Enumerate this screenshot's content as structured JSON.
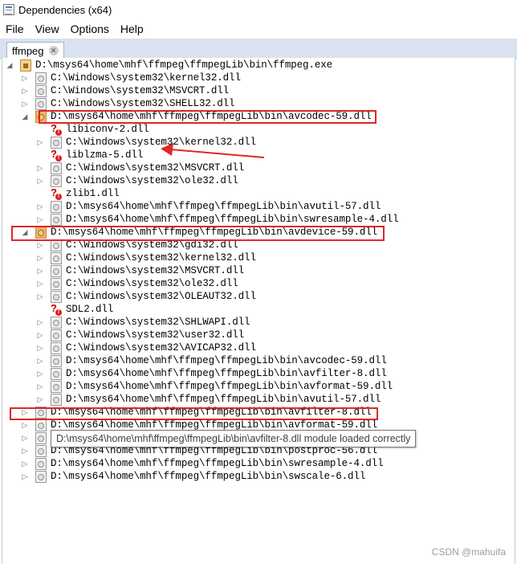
{
  "window": {
    "title": "Dependencies (x64)"
  },
  "menu": [
    "File",
    "View",
    "Options",
    "Help"
  ],
  "tabs": [
    {
      "label": "ffmpeg",
      "close_glyph": "✕"
    }
  ],
  "tree": [
    {
      "depth": 0,
      "expander": "expanded",
      "icon": "exe",
      "label": "D:\\msys64\\home\\mhf\\ffmpeg\\ffmpegLib\\bin\\ffmpeg.exe"
    },
    {
      "depth": 1,
      "expander": "collapsed",
      "icon": "dll",
      "label": "C:\\Windows\\system32\\kernel32.dll"
    },
    {
      "depth": 1,
      "expander": "collapsed",
      "icon": "dll",
      "label": "C:\\Windows\\system32\\MSVCRT.dll"
    },
    {
      "depth": 1,
      "expander": "collapsed",
      "icon": "dll",
      "label": "C:\\Windows\\system32\\SHELL32.dll"
    },
    {
      "depth": 1,
      "expander": "expanded",
      "icon": "hl",
      "label": "D:\\msys64\\home\\mhf\\ffmpeg\\ffmpegLib\\bin\\avcodec-59.dll"
    },
    {
      "depth": 2,
      "expander": "none",
      "icon": "missing",
      "label": "libiconv-2.dll"
    },
    {
      "depth": 2,
      "expander": "collapsed",
      "icon": "dll",
      "label": "C:\\Windows\\system32\\kernel32.dll"
    },
    {
      "depth": 2,
      "expander": "none",
      "icon": "missing",
      "label": "liblzma-5.dll"
    },
    {
      "depth": 2,
      "expander": "collapsed",
      "icon": "dll",
      "label": "C:\\Windows\\system32\\MSVCRT.dll"
    },
    {
      "depth": 2,
      "expander": "collapsed",
      "icon": "dll",
      "label": "C:\\Windows\\system32\\ole32.dll"
    },
    {
      "depth": 2,
      "expander": "none",
      "icon": "missing",
      "label": "zlib1.dll"
    },
    {
      "depth": 2,
      "expander": "collapsed",
      "icon": "dll",
      "label": "D:\\msys64\\home\\mhf\\ffmpeg\\ffmpegLib\\bin\\avutil-57.dll"
    },
    {
      "depth": 2,
      "expander": "collapsed",
      "icon": "dll",
      "label": "D:\\msys64\\home\\mhf\\ffmpeg\\ffmpegLib\\bin\\swresample-4.dll"
    },
    {
      "depth": 1,
      "expander": "expanded",
      "icon": "hl",
      "label": "D:\\msys64\\home\\mhf\\ffmpeg\\ffmpegLib\\bin\\avdevice-59.dll"
    },
    {
      "depth": 2,
      "expander": "collapsed",
      "icon": "dll",
      "label": "C:\\Windows\\system32\\gdi32.dll"
    },
    {
      "depth": 2,
      "expander": "collapsed",
      "icon": "dll",
      "label": "C:\\Windows\\system32\\kernel32.dll"
    },
    {
      "depth": 2,
      "expander": "collapsed",
      "icon": "dll",
      "label": "C:\\Windows\\system32\\MSVCRT.dll"
    },
    {
      "depth": 2,
      "expander": "collapsed",
      "icon": "dll",
      "label": "C:\\Windows\\system32\\ole32.dll"
    },
    {
      "depth": 2,
      "expander": "collapsed",
      "icon": "dll",
      "label": "C:\\Windows\\system32\\OLEAUT32.dll"
    },
    {
      "depth": 2,
      "expander": "none",
      "icon": "missing",
      "label": "SDL2.dll"
    },
    {
      "depth": 2,
      "expander": "collapsed",
      "icon": "dll",
      "label": "C:\\Windows\\system32\\SHLWAPI.dll"
    },
    {
      "depth": 2,
      "expander": "collapsed",
      "icon": "dll",
      "label": "C:\\Windows\\system32\\user32.dll"
    },
    {
      "depth": 2,
      "expander": "collapsed",
      "icon": "dll",
      "label": "C:\\Windows\\system32\\AVICAP32.dll"
    },
    {
      "depth": 2,
      "expander": "collapsed",
      "icon": "dll",
      "label": "D:\\msys64\\home\\mhf\\ffmpeg\\ffmpegLib\\bin\\avcodec-59.dll"
    },
    {
      "depth": 2,
      "expander": "collapsed",
      "icon": "dll",
      "label": "D:\\msys64\\home\\mhf\\ffmpeg\\ffmpegLib\\bin\\avfilter-8.dll"
    },
    {
      "depth": 2,
      "expander": "collapsed",
      "icon": "dll",
      "label": "D:\\msys64\\home\\mhf\\ffmpeg\\ffmpegLib\\bin\\avformat-59.dll"
    },
    {
      "depth": 2,
      "expander": "collapsed",
      "icon": "dll",
      "label": "D:\\msys64\\home\\mhf\\ffmpeg\\ffmpegLib\\bin\\avutil-57.dll"
    },
    {
      "depth": 1,
      "expander": "collapsed",
      "icon": "dll",
      "label": "D:\\msys64\\home\\mhf\\ffmpeg\\ffmpegLib\\bin\\avfilter-8.dll"
    },
    {
      "depth": 1,
      "expander": "collapsed",
      "icon": "dll",
      "label": "D:\\msys64\\home\\mhf\\ffmpeg\\ffmpegLib\\bin\\avformat-59.dll"
    },
    {
      "depth": 1,
      "expander": "collapsed",
      "icon": "dll",
      "label": "D:\\msys64\\home\\mhf\\ffmpeg\\ffmpegLib\\bin\\avutil-57.dll"
    },
    {
      "depth": 1,
      "expander": "collapsed",
      "icon": "dll",
      "label": "D:\\msys64\\home\\mhf\\ffmpeg\\ffmpegLib\\bin\\postproc-56.dll"
    },
    {
      "depth": 1,
      "expander": "collapsed",
      "icon": "dll",
      "label": "D:\\msys64\\home\\mhf\\ffmpeg\\ffmpegLib\\bin\\swresample-4.dll"
    },
    {
      "depth": 1,
      "expander": "collapsed",
      "icon": "dll",
      "label": "D:\\msys64\\home\\mhf\\ffmpeg\\ffmpegLib\\bin\\swscale-6.dll"
    }
  ],
  "tooltip": "D:\\msys64\\home\\mhf\\ffmpeg\\ffmpegLib\\bin\\avfilter-8.dll module loaded correctly",
  "watermark": "CSDN @mahuifa",
  "colors": {
    "annotation_red": "#e02727",
    "missing_icon_red": "#c00000",
    "tab_strip": "#d9e2ee"
  }
}
